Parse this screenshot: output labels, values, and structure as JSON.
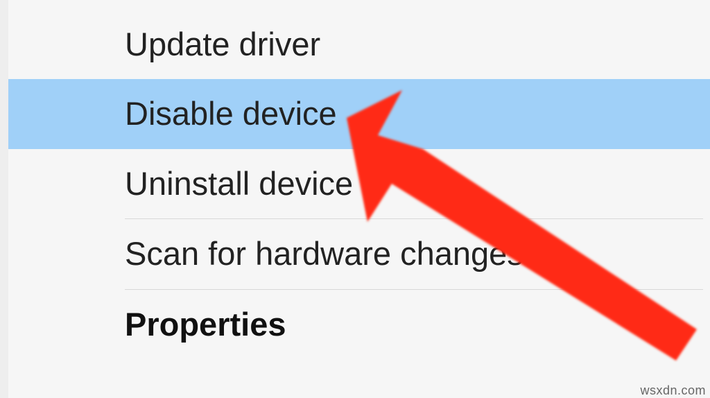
{
  "context_menu": {
    "items": [
      {
        "label": "Update driver",
        "highlighted": false
      },
      {
        "label": "Disable device",
        "highlighted": true
      },
      {
        "label": "Uninstall device",
        "highlighted": false
      },
      {
        "label": "Scan for hardware changes",
        "highlighted": false
      },
      {
        "label": "Properties",
        "highlighted": false,
        "bold": true
      }
    ]
  },
  "annotation": {
    "type": "arrow",
    "color": "#ff2a12",
    "target_item": "Disable device"
  },
  "watermark": "wsxdn.com"
}
